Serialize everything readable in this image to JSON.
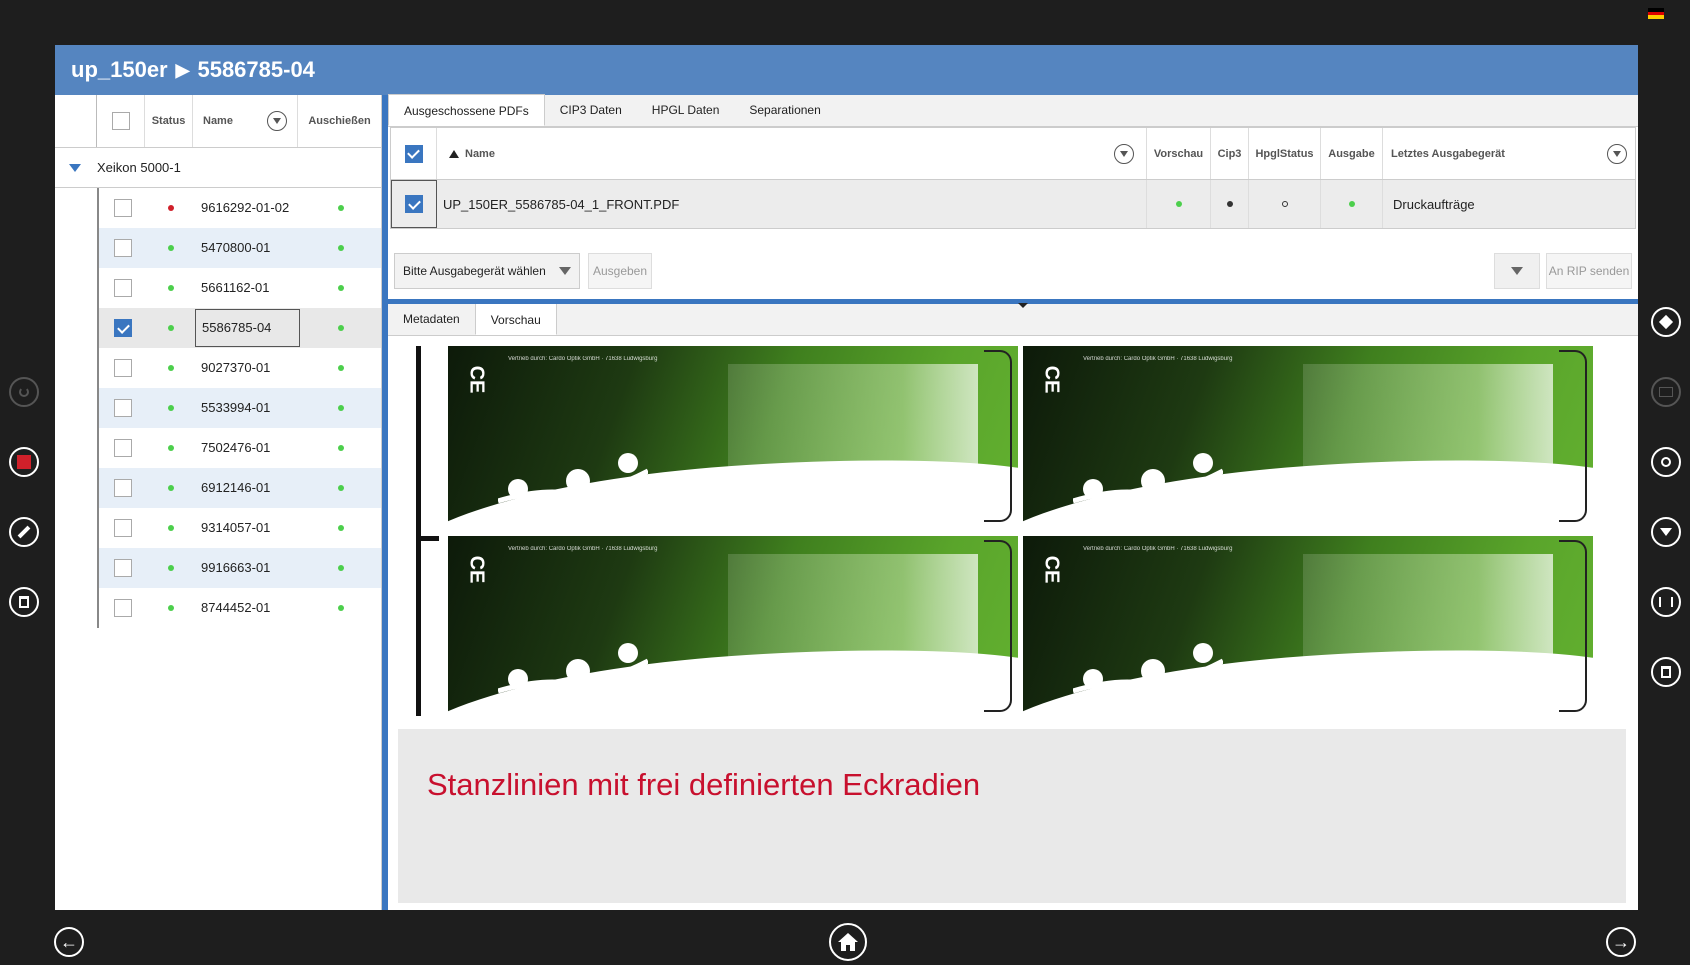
{
  "window": {
    "title_left": "up_150er",
    "title_sep": "▶",
    "title_right": "5586785-04"
  },
  "left_table": {
    "headers": {
      "status": "Status",
      "name": "Name",
      "impose": "Auschießen"
    },
    "group": "Xeikon 5000-1",
    "rows": [
      {
        "name": "9616292-01-02",
        "checked": false,
        "status": "error",
        "impose": "ok"
      },
      {
        "name": "5470800-01",
        "checked": false,
        "status": "ok",
        "impose": "ok"
      },
      {
        "name": "5661162-01",
        "checked": false,
        "status": "ok",
        "impose": "ok"
      },
      {
        "name": "5586785-04",
        "checked": true,
        "status": "ok",
        "impose": "ok"
      },
      {
        "name": "9027370-01",
        "checked": false,
        "status": "ok",
        "impose": "ok"
      },
      {
        "name": "5533994-01",
        "checked": false,
        "status": "ok",
        "impose": "ok"
      },
      {
        "name": "7502476-01",
        "checked": false,
        "status": "ok",
        "impose": "ok"
      },
      {
        "name": "6912146-01",
        "checked": false,
        "status": "ok",
        "impose": "ok"
      },
      {
        "name": "9314057-01",
        "checked": false,
        "status": "ok",
        "impose": "ok"
      },
      {
        "name": "9916663-01",
        "checked": false,
        "status": "ok",
        "impose": "ok"
      },
      {
        "name": "8744452-01",
        "checked": false,
        "status": "ok",
        "impose": "ok"
      }
    ]
  },
  "top_tabs": [
    "Ausgeschossene PDFs",
    "CIP3 Daten",
    "HPGL Daten",
    "Separationen"
  ],
  "pdf_table": {
    "headers": {
      "name": "Name",
      "preview": "Vorschau",
      "cip3": "Cip3",
      "hpgl": "HpglStatus",
      "output": "Ausgabe",
      "last_device": "Letztes Ausgabegerät"
    },
    "rows": [
      {
        "name": "UP_150ER_5586785-04_1_FRONT.PDF",
        "last_device": "Druckaufträge"
      }
    ]
  },
  "actions": {
    "device_select": "Bitte Ausgabegerät wählen",
    "output_button": "Ausgeben",
    "rip_button": "An RIP senden"
  },
  "bottom_tabs": [
    "Metadaten",
    "Vorschau"
  ],
  "label_art": {
    "ce_mark": "CE",
    "micro_text": "Vertrieb durch: Cardo Optik GmbH · 71638 Ludwigsburg"
  },
  "caption": "Stanzlinien mit frei definierten Eckradien",
  "colors": {
    "accent": "#3a76c0",
    "titlebar": "#5585c0",
    "status_ok": "#4ccf4c",
    "status_error": "#d0202a",
    "caption_text": "#c8102e"
  }
}
